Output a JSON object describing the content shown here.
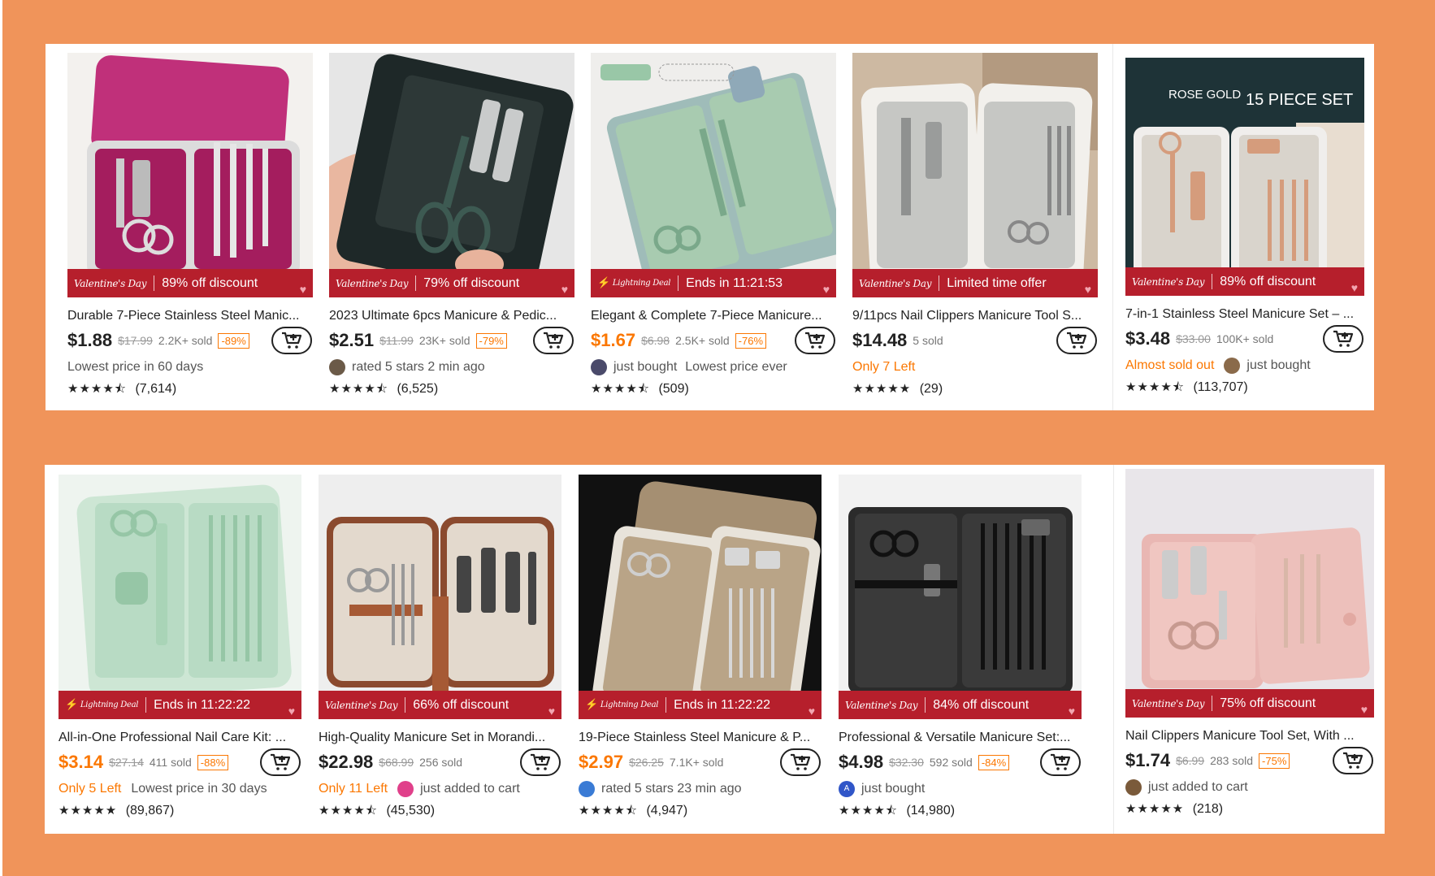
{
  "colors": {
    "background": "#f0945a",
    "accent": "#fb7701",
    "banner": "#b61f2c"
  },
  "icons": {
    "cart": "add-to-cart-icon",
    "heart": "heart-icon",
    "bolt": "lightning-icon"
  },
  "rows": [
    {
      "products": [
        {
          "banner_tag": "Valentine's Day",
          "banner_text": "89% off discount",
          "title": "Durable 7-Piece Stainless Steel Manic...",
          "price": "$1.88",
          "orig_price": "$17.99",
          "sold": "2.2K+ sold",
          "discount": "-89%",
          "highlight": "",
          "info": "Lowest price in 60 days",
          "social": "",
          "stars": "★★★★⯪",
          "reviews": "(7,614)"
        },
        {
          "banner_tag": "Valentine's Day",
          "banner_text": "79% off discount",
          "title": "2023 Ultimate 6pcs Manicure & Pedic...",
          "price": "$2.51",
          "orig_price": "$11.99",
          "sold": "23K+ sold",
          "discount": "-79%",
          "highlight": "",
          "info": "",
          "social": "rated 5 stars 2 min ago",
          "stars": "★★★★⯪",
          "reviews": "(6,525)"
        },
        {
          "banner_tag": "Lightning Deal",
          "banner_text": "Ends in 11:21:53",
          "title": "Elegant & Complete 7-Piece Manicure...",
          "price": "$1.67",
          "orig_price": "$6.98",
          "sold": "2.5K+ sold",
          "discount": "-76%",
          "highlight": "",
          "info": "Lowest price ever",
          "social": "just bought",
          "stars": "★★★★⯪",
          "reviews": "(509)"
        },
        {
          "banner_tag": "Valentine's Day",
          "banner_text": "Limited time offer",
          "title": "9/11pcs Nail Clippers Manicure Tool S...",
          "price": "$14.48",
          "orig_price": "",
          "sold": "5 sold",
          "discount": "",
          "highlight": "Only 7 Left",
          "info": "",
          "social": "",
          "stars": "★★★★★",
          "reviews": "(29)"
        },
        {
          "banner_tag": "Valentine's Day",
          "banner_text": "89% off discount",
          "image_text_1": "ROSE GOLD",
          "image_text_2": "15 PIECE SET",
          "title": "7-in-1 Stainless Steel Manicure Set – ...",
          "price": "$3.48",
          "orig_price": "$33.00",
          "sold": "100K+ sold",
          "discount": "",
          "highlight": "Almost sold out",
          "info": "",
          "social": "just bought",
          "stars": "★★★★⯪",
          "reviews": "(113,707)"
        }
      ]
    },
    {
      "products": [
        {
          "banner_tag": "Lightning Deal",
          "banner_text": "Ends in 11:22:22",
          "title": "All-in-One Professional Nail Care Kit: ...",
          "price": "$3.14",
          "orig_price": "$27.14",
          "sold": "411 sold",
          "discount": "-88%",
          "highlight": "Only 5 Left",
          "info": "Lowest price in 30 days",
          "social": "",
          "stars": "★★★★★",
          "reviews": "(89,867)"
        },
        {
          "banner_tag": "Valentine's Day",
          "banner_text": "66% off discount",
          "title": "High-Quality Manicure Set in Morandi...",
          "price": "$22.98",
          "orig_price": "$68.99",
          "sold": "256 sold",
          "discount": "",
          "highlight": "Only 11 Left",
          "info": "",
          "social": "just added to cart",
          "stars": "★★★★⯪",
          "reviews": "(45,530)"
        },
        {
          "banner_tag": "Lightning Deal",
          "banner_text": "Ends in 11:22:22",
          "title": "19-Piece Stainless Steel Manicure & P...",
          "price": "$2.97",
          "orig_price": "$26.25",
          "sold": "7.1K+ sold",
          "discount": "",
          "highlight": "",
          "info": "",
          "social": "rated 5 stars 23 min ago",
          "stars": "★★★★⯪",
          "reviews": "(4,947)"
        },
        {
          "banner_tag": "Valentine's Day",
          "banner_text": "84% off discount",
          "title": "Professional & Versatile Manicure Set:...",
          "price": "$4.98",
          "orig_price": "$32.30",
          "sold": "592 sold",
          "discount": "-84%",
          "highlight": "",
          "info": "",
          "social": "just bought",
          "avatar_letter": "A",
          "stars": "★★★★⯪",
          "reviews": "(14,980)"
        },
        {
          "banner_tag": "Valentine's Day",
          "banner_text": "75% off discount",
          "title": "Nail Clippers Manicure Tool Set, With ...",
          "price": "$1.74",
          "orig_price": "$6.99",
          "sold": "283 sold",
          "discount": "-75%",
          "highlight": "",
          "info": "",
          "social": "just added to cart",
          "stars": "★★★★★",
          "reviews": "(218)"
        }
      ]
    }
  ]
}
